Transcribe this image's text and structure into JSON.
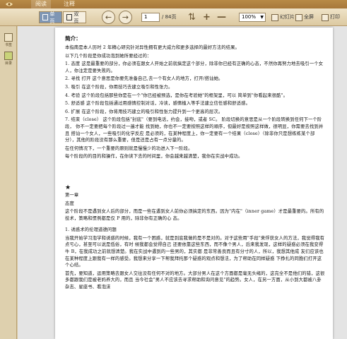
{
  "tabs": {
    "read": "阅读",
    "notes": "注释"
  },
  "toolbar": {
    "single_page": "单页",
    "double_page": "双页",
    "page_current": "1",
    "page_total": "/ 84页",
    "zoom": "100%",
    "slideshow": "幻灯片",
    "fullscreen": "全屏",
    "print": "打印"
  },
  "sidebar": {
    "book": "书签",
    "toc": "目录"
  },
  "page": {
    "heading": "简介：",
    "intro": [
      "本指南是本人历时 2 年精心研究针对异性拥有更大威力和更多选择的最好方法的结果。",
      "以下几个阶段是你成功泡到她所要经过的："
    ],
    "steps": [
      "1. 态度 这是最重要的部分，你必须在跟女人开始之前就搞定这个部分，除非你已经有正确的心态，不然你再努力地去吸引一个女人，你注定是要失败的。",
      "2. 寻找 打开 这个意思是你要先准备自己,去一个有女人的地方，打开/搭讪她。",
      "3. 吸引 在这个阶段，你用技巧去建立吸引和性张力。",
      "4. 考验 这个阶段包括那些你是在一个\"你已经被预选，是你在考验她\"的框架里，可以 简单到\"你看起来很酷\"。",
      "5. 舒适感 这个阶段包括通过用感情控制对话，冷读，感情植入等手法建立信任感和舒适感。",
      "6. 扩展 在这个阶段，你将用技巧建立的吸引和性张力提升到一个更高的层次。",
      "7. 结束（close） 这个阶段包括\"封底\"（要到电话，约会，接吻，或者 SC。 阶段切换的意思是从一个阶段转换到任何下一个阶段， 你不一定要把每个阶段过一遍才能 找到她，你也不一定要按照这样的顺序，但最好是按照这样做，很明显，你需要去找到并且 搭讪一个女人，一些吸引的化学反应 是必须的，在某种程度上，你一定要有一个结果（close）（除非你只是想练练某个部分），其他的阶段没有那么重要，但是还是占有一点分量的。"
    ],
    "outro": [
      "在任何情况下，一个重要的原则就是慢慢少的功进入下一阶段。",
      "每个阶段的的目的和操作，在你读下去的时间里，你会越来越清楚，我你在实战中成功。"
    ],
    "star": "★",
    "chapter": "第一章",
    "chapter_title": "态度",
    "chapter_text": "这个阶段不是遇到女人后的部分，而是一些在遇到女人前你必须搞定的东西。因为\"内在\"（inner game）才是最重要的。所有的技术，策略和惯例都是仅 P 用的，除非你有正确的心 态。",
    "section": "1. 诱惑术的伦理道德问题",
    "section_text": [
      "当我开始学习泡学和诱惑的时候，我有一个困惑，就是到底我做的是不是对的。对于这些用\"手段\"来俘获女人的方法，我觉得我有点亏心，甚至可以说是低俗，有时 候我都会觉得自己 还要依靠这些东西，而不像个男人，后来我发现，这样的疑惑必须在我变得牛 B，在我成功之前就想清楚。我在实战中遇到的一些男的，其实都 是非常善良而且有分寸的人，所以，我想其他成 友们应该也在某种程度上跟我有一样的感受。我想来分享一下帮我拜托那个疑惑的观点和想法，为了帮助在同样疑惑 下挣扎的同胞们打开这个心结。",
      "首先，要知道，运用策略去跟女人交往没有任何不对的地方。大部分男人在这个方面都是毫无头绪的，这完全不是他们的错，这很多都跟我们是被老妈养大的，而且 当今社会\"男人不应该去寻求帮助和询问意见\"的趋势。女人，在另一方面，从小到大都被八卦杂志、星座书、看泡沫"
    ]
  }
}
